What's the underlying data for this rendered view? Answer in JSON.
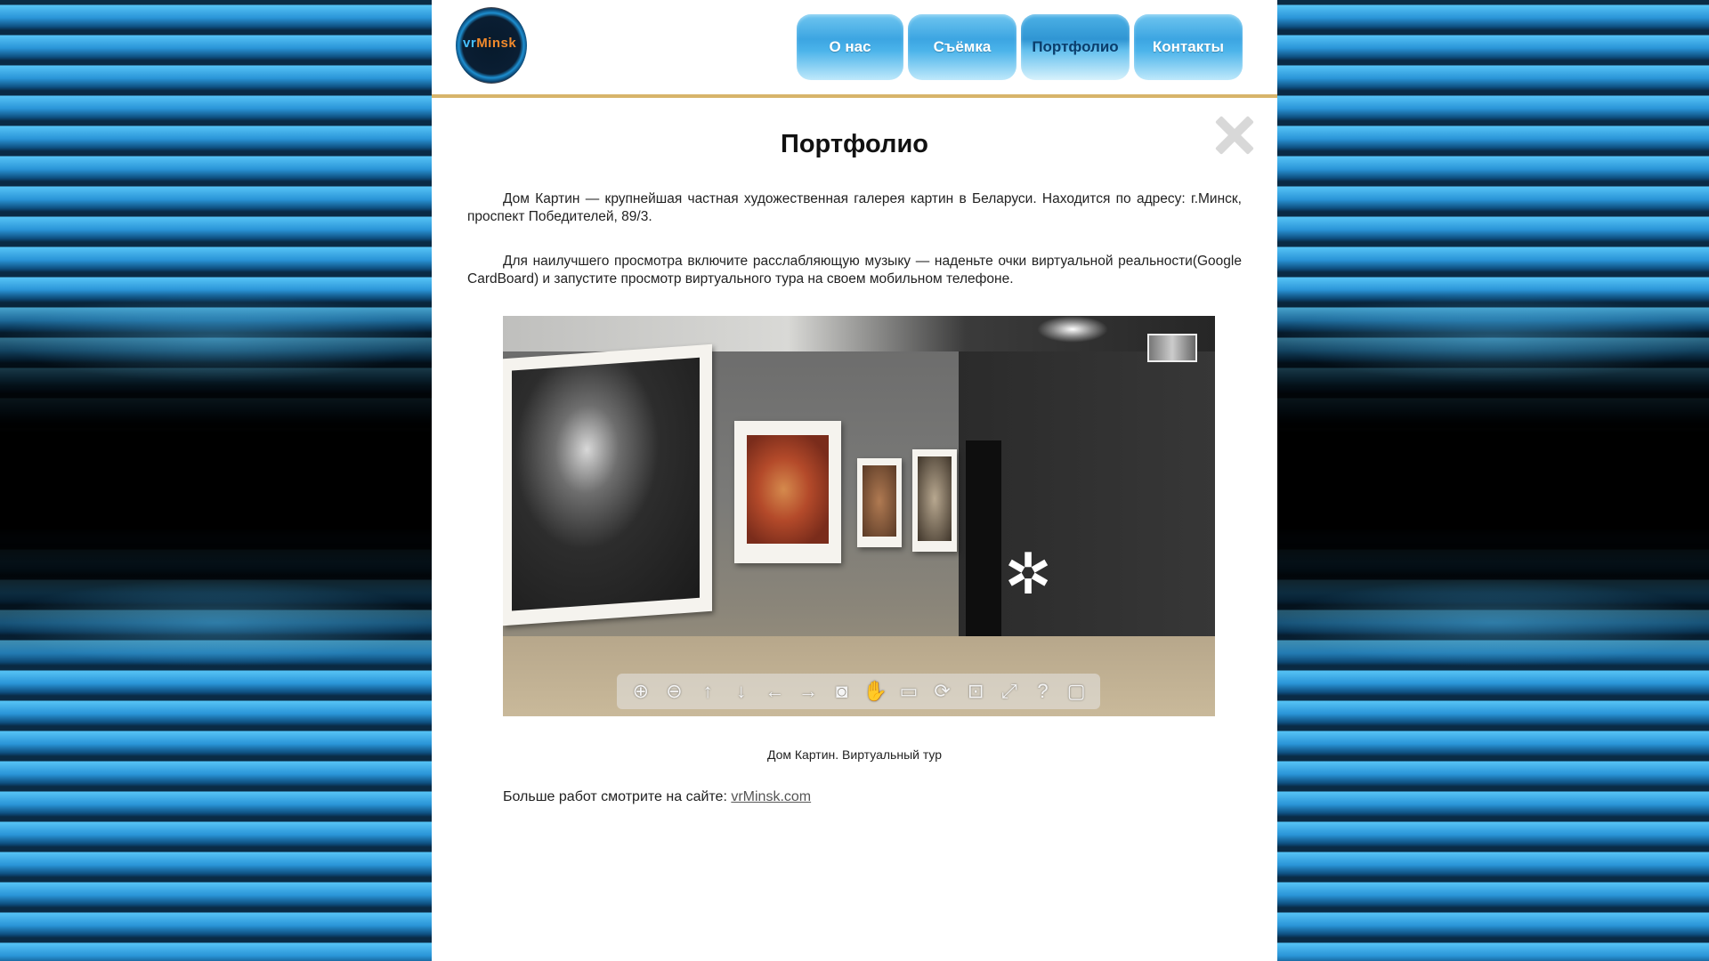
{
  "colors": {
    "header_border": "#d7b46a",
    "nav_button": "#3ca5e2",
    "nav_active_text": "#0b3d6b",
    "background_tile": "#2a95d8"
  },
  "header": {
    "logo": {
      "text_a": "vr",
      "text_b": "Minsk"
    },
    "nav": [
      {
        "label": "О нас",
        "active": false
      },
      {
        "label": "Съёмка",
        "active": false
      },
      {
        "label": "Портфолио",
        "active": true
      },
      {
        "label": "Контакты",
        "active": false
      }
    ]
  },
  "main": {
    "close_icon": "close-icon",
    "title": "Портфолио",
    "paragraphs": [
      "Дом Картин — крупнейшая частная художественная галерея картин в Беларуси. Находится по адресу: г.Минск, проспект Победителей, 89/3.",
      "Для наилучшего просмотра включите расслабляющую музыку — наденьте очки виртуальной реальности(Google CardBoard) и запустите просмотр виртуального тура на своем мобильном телефоне."
    ],
    "viewer": {
      "toolbar": [
        {
          "name": "zoom-in-icon",
          "glyph": "⊕"
        },
        {
          "name": "zoom-out-icon",
          "glyph": "⊖"
        },
        {
          "name": "arrow-up-icon",
          "glyph": "↑"
        },
        {
          "name": "arrow-down-icon",
          "glyph": "↓"
        },
        {
          "name": "arrow-left-icon",
          "glyph": "←"
        },
        {
          "name": "arrow-right-icon",
          "glyph": "→"
        },
        {
          "name": "vr-glasses-icon",
          "glyph": "◙"
        },
        {
          "name": "hand-icon",
          "glyph": "✋"
        },
        {
          "name": "thumbnails-icon",
          "glyph": "▭"
        },
        {
          "name": "autorotate-icon",
          "glyph": "⟳"
        },
        {
          "name": "gyroscope-icon",
          "glyph": "⊡"
        },
        {
          "name": "fullscreen-icon",
          "glyph": "⤢"
        },
        {
          "name": "help-icon",
          "glyph": "?"
        },
        {
          "name": "hide-toolbar-icon",
          "glyph": "▢"
        }
      ],
      "loading_icon": "spinner-icon"
    },
    "caption": "Дом Картин. Виртуальный тур",
    "more_text": "Больше работ смотрите на сайте:",
    "more_link": "vrMinsk.com"
  }
}
